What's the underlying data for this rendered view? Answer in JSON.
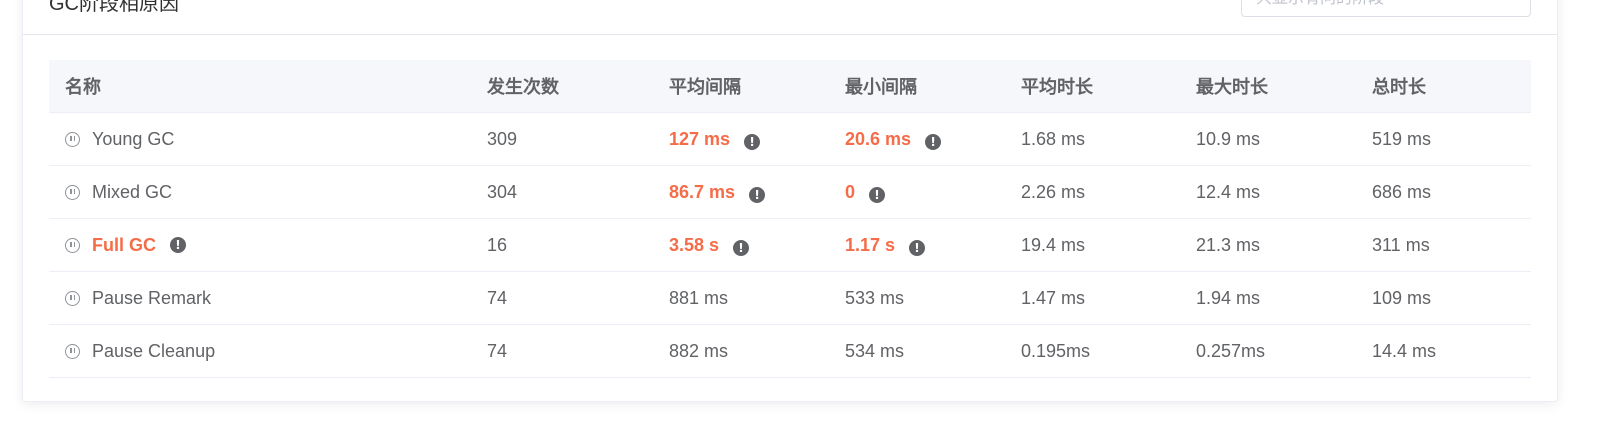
{
  "panel": {
    "title": "GC阶段相原因",
    "filter_placeholder": "只显示有问的阶段"
  },
  "table": {
    "columns": [
      "名称",
      "发生次数",
      "平均间隔",
      "最小间隔",
      "平均时长",
      "最大时长",
      "总时长"
    ],
    "rows": [
      {
        "name": "Young GC",
        "count": "309",
        "avg_interval": "127 ms",
        "min_interval": "20.6 ms",
        "avg_duration": "1.68 ms",
        "max_duration": "10.9 ms",
        "total": "519 ms"
      },
      {
        "name": "Mixed GC",
        "count": "304",
        "avg_interval": "86.7 ms",
        "min_interval": "0",
        "avg_duration": "2.26 ms",
        "max_duration": "12.4 ms",
        "total": "686 ms"
      },
      {
        "name": "Full GC",
        "count": "16",
        "avg_interval": "3.58 s",
        "min_interval": "1.17 s",
        "avg_duration": "19.4 ms",
        "max_duration": "21.3 ms",
        "total": "311 ms"
      },
      {
        "name": "Pause Remark",
        "count": "74",
        "avg_interval": "881 ms",
        "min_interval": "533 ms",
        "avg_duration": "1.47 ms",
        "max_duration": "1.94 ms",
        "total": "109 ms"
      },
      {
        "name": "Pause Cleanup",
        "count": "74",
        "avg_interval": "882 ms",
        "min_interval": "534 ms",
        "avg_duration": "0.195ms",
        "max_duration": "0.257ms",
        "total": "14.4 ms"
      }
    ]
  },
  "icons": {
    "row_icon": "pause-circle-icon",
    "warning_icon": "exclamation-circle-icon",
    "warning_glyph": "!"
  },
  "colors": {
    "warning_text": "#f56c48",
    "header_bg": "#f5f7fa",
    "border": "#ebeef5"
  }
}
